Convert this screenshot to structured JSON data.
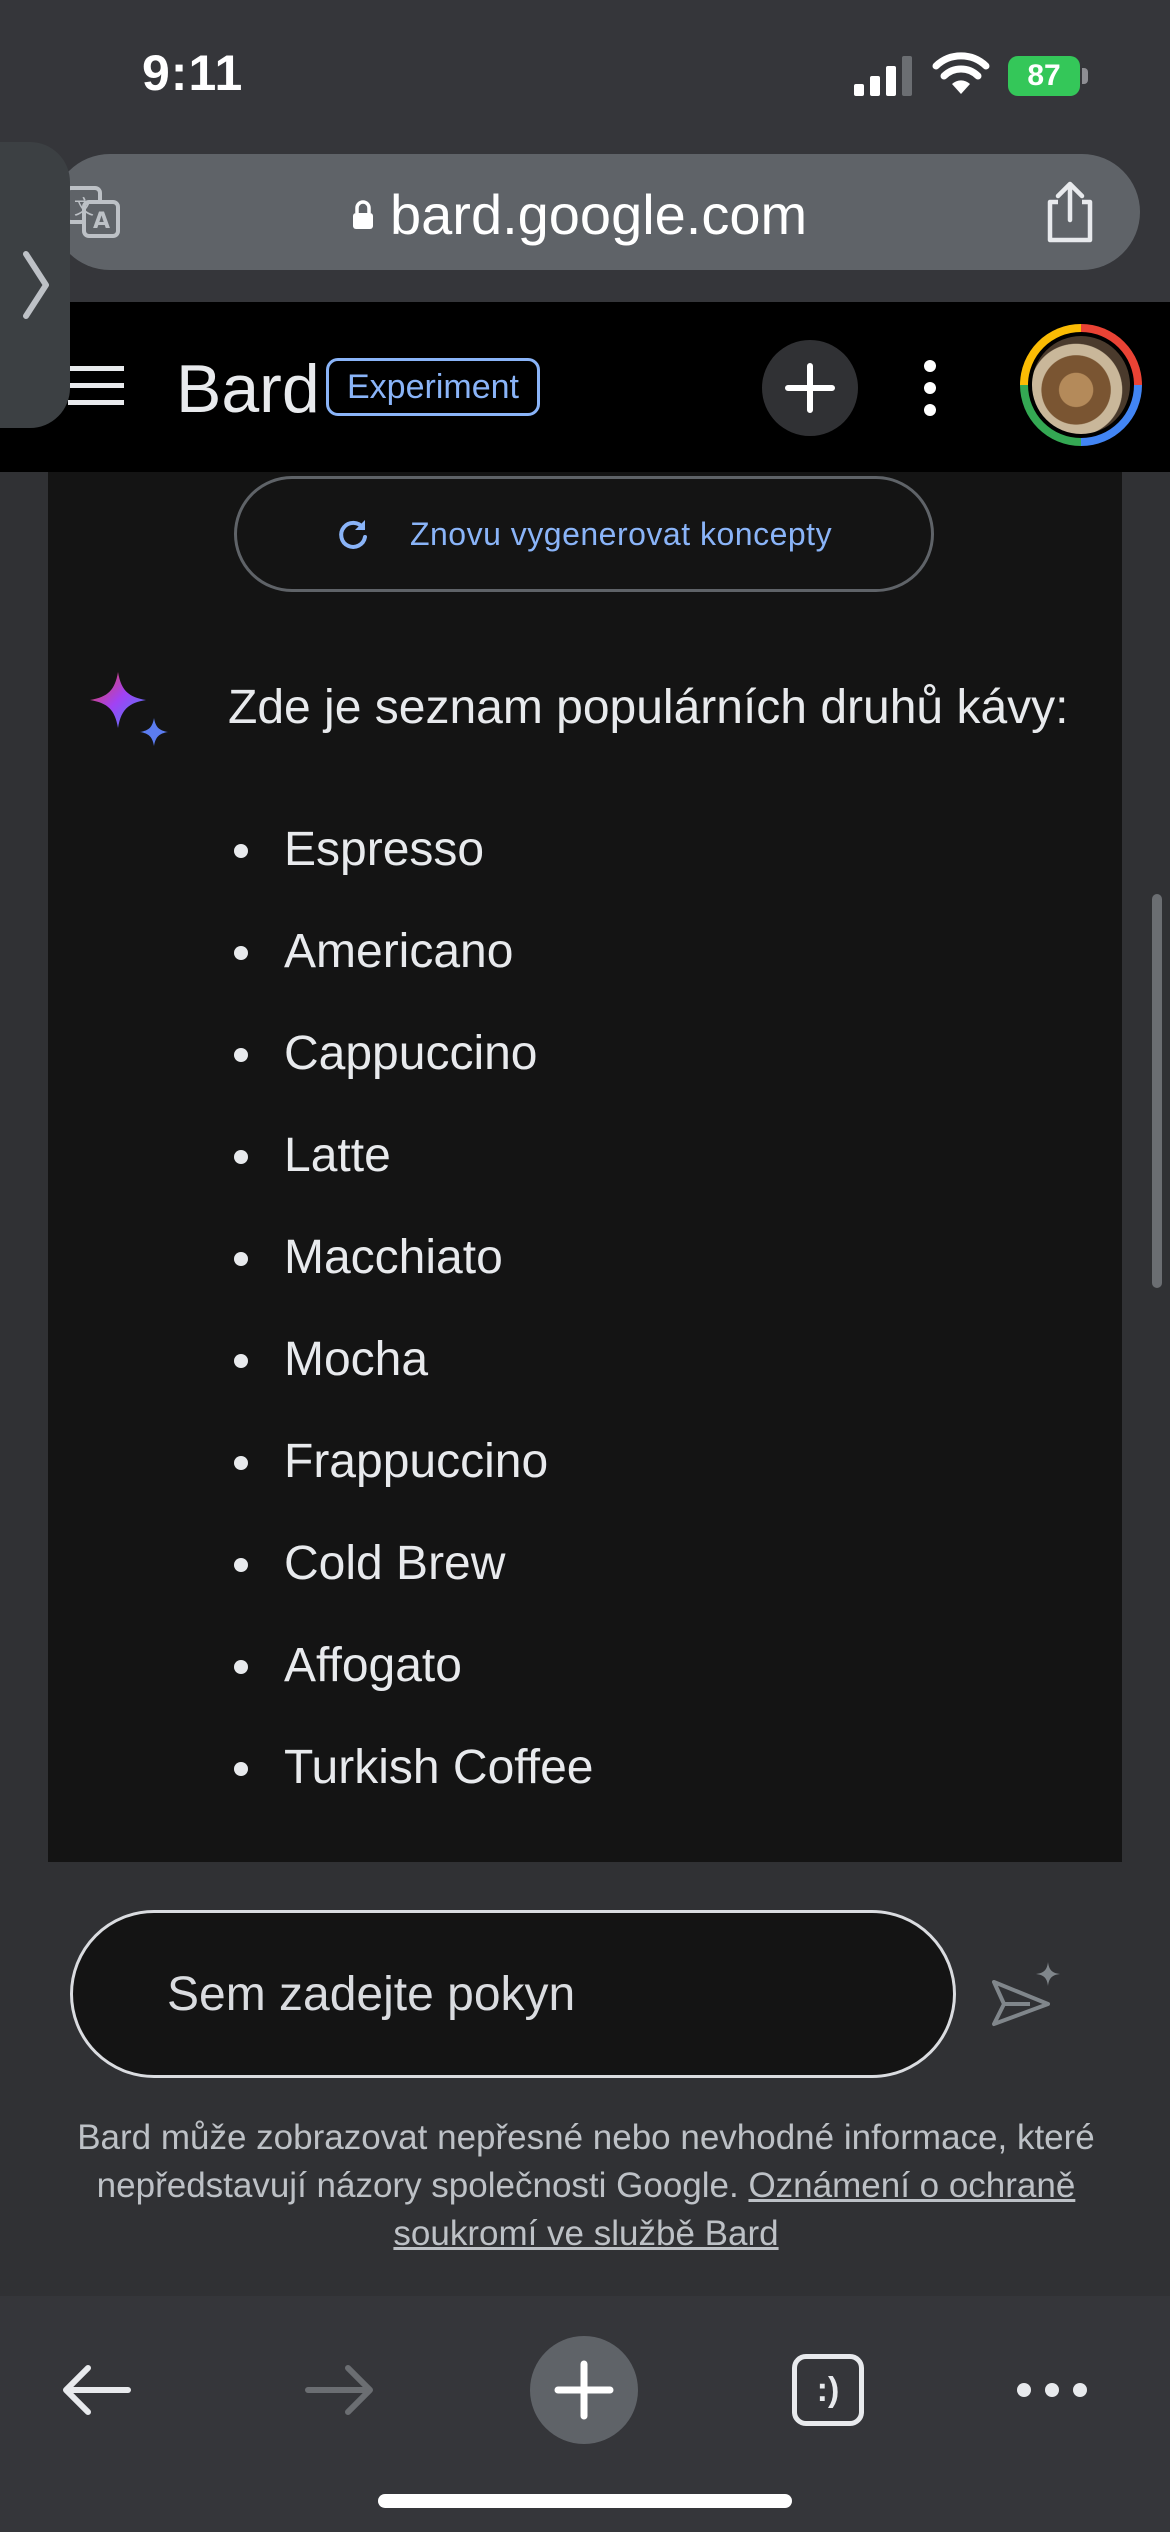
{
  "status_bar": {
    "time": "9:11",
    "battery_level": "87"
  },
  "browser": {
    "url": "bard.google.com",
    "icons": {
      "translate": "translate-icon",
      "lock": "lock-icon",
      "share": "share-icon",
      "side_panel": "chevron-right-icon"
    }
  },
  "header": {
    "brand": "Bard",
    "badge": "Experiment",
    "icons": {
      "menu": "menu-icon",
      "new_chat": "plus-icon",
      "more": "more-vert-icon",
      "avatar": "avatar"
    }
  },
  "response": {
    "regenerate_label": "Znovu vygenerovat koncepty",
    "intro": "Zde je seznam populárních druhů kávy:",
    "items": [
      "Espresso",
      "Americano",
      "Cappuccino",
      "Latte",
      "Macchiato",
      "Mocha",
      "Frappuccino",
      "Cold Brew",
      "Affogato",
      "Turkish Coffee"
    ]
  },
  "prompt": {
    "placeholder": "Sem zadejte pokyn",
    "value": ""
  },
  "disclaimer": {
    "text": "Bard může zobrazovat nepřesné nebo nevhodné informace, které nepředstavují názory společnosti Google. ",
    "link": "Oznámení o ochraně soukromí ve službě Bard"
  },
  "toolbar": {
    "tabs_label": ":)",
    "icons": {
      "back": "arrow-left-icon",
      "forward": "arrow-right-icon",
      "new_tab": "plus-icon",
      "tabs": "tabs-icon",
      "more": "more-horiz-icon"
    }
  },
  "colors": {
    "accent_blue": "#8ab4f8",
    "battery_green": "#34c759",
    "header_bg": "#000000",
    "content_bg": "#141414",
    "chrome_bg": "#35363a"
  }
}
